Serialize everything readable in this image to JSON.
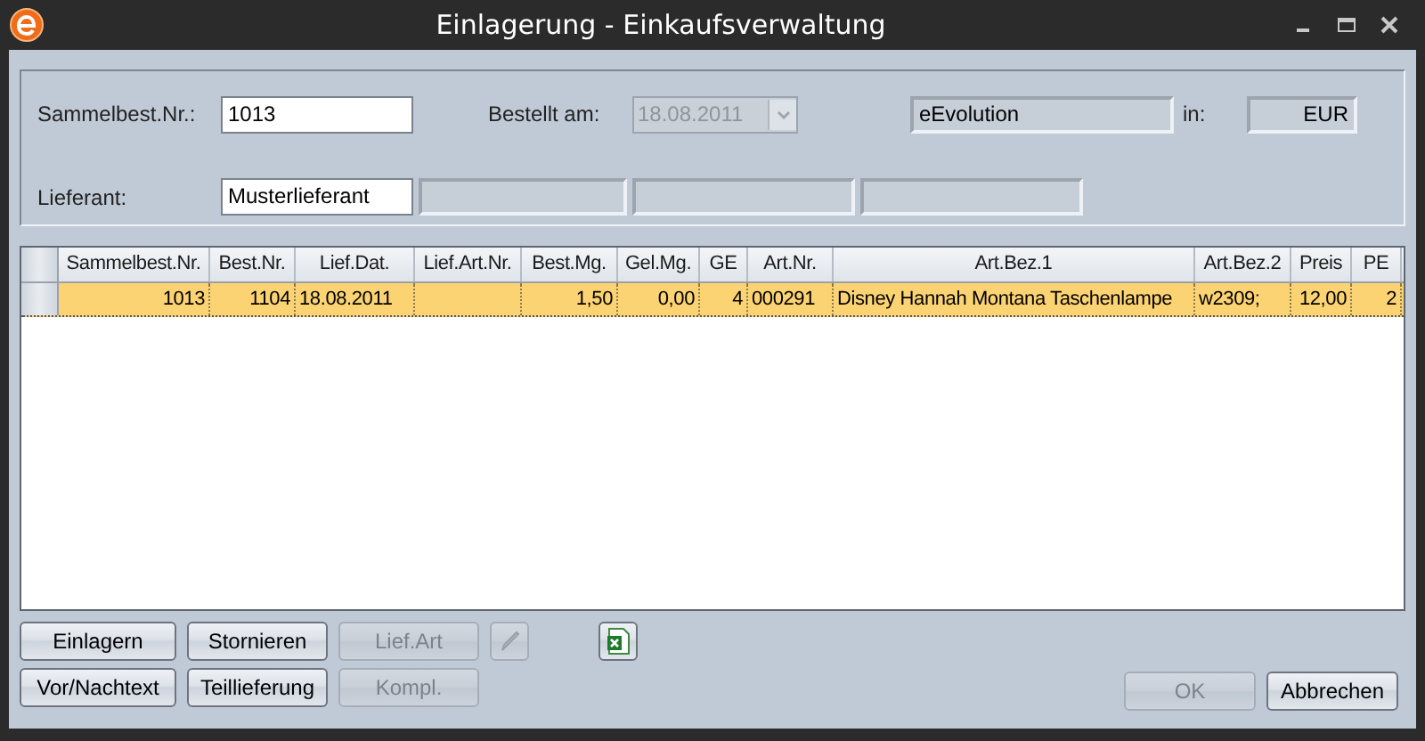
{
  "window": {
    "title": "Einlagerung - Einkaufsverwaltung"
  },
  "form": {
    "order_no_label": "Sammelbest.Nr.:",
    "order_no": "1013",
    "ordered_label": "Bestellt am:",
    "ordered_date": {
      "value": "18.08.2011",
      "disabled": true
    },
    "company": "eEvolution",
    "in_label": "in:",
    "currency": "EUR",
    "supplier_label": "Lieferant:",
    "supplier": "Musterlieferant"
  },
  "table": {
    "columns": [
      {
        "label": "Sammelbest.Nr.",
        "kind": "number"
      },
      {
        "label": "Best.Nr.",
        "kind": "number"
      },
      {
        "label": "Lief.Dat.",
        "kind": "text"
      },
      {
        "label": "Lief.Art.Nr.",
        "kind": "text"
      },
      {
        "label": "Best.Mg.",
        "kind": "number"
      },
      {
        "label": "Gel.Mg.",
        "kind": "number"
      },
      {
        "label": "GE",
        "kind": "number"
      },
      {
        "label": "Art.Nr.",
        "kind": "text"
      },
      {
        "label": "Art.Bez.1",
        "kind": "text"
      },
      {
        "label": "Art.Bez.2",
        "kind": "text"
      },
      {
        "label": "Preis",
        "kind": "number"
      },
      {
        "label": "PE",
        "kind": "number"
      }
    ],
    "rows": [
      {
        "selected": true,
        "cells": [
          "1013",
          "1104",
          "18.08.2011",
          "",
          "1,50",
          "0,00",
          "4",
          "000291",
          "Disney Hannah Montana Taschenlampe",
          "w2309;",
          "12,00",
          "2"
        ]
      }
    ]
  },
  "buttons": [
    {
      "kind": "text",
      "label": "Einlagern",
      "disabled": false
    },
    {
      "kind": "text",
      "label": "Stornieren",
      "disabled": false
    },
    {
      "kind": "text",
      "label": "Lief.Art",
      "disabled": true
    },
    {
      "kind": "pen",
      "disabled": true
    },
    {
      "kind": "spreadsheet",
      "disabled": false
    },
    {
      "kind": "text",
      "label": "Vor/Nachtext",
      "disabled": false
    },
    {
      "kind": "text",
      "label": "Teillieferung",
      "disabled": false
    },
    {
      "kind": "text",
      "label": "Kompl.",
      "disabled": true
    }
  ],
  "dialog_buttons": [
    {
      "label": "OK",
      "disabled": true
    },
    {
      "label": "Abbrechen",
      "disabled": false
    }
  ]
}
